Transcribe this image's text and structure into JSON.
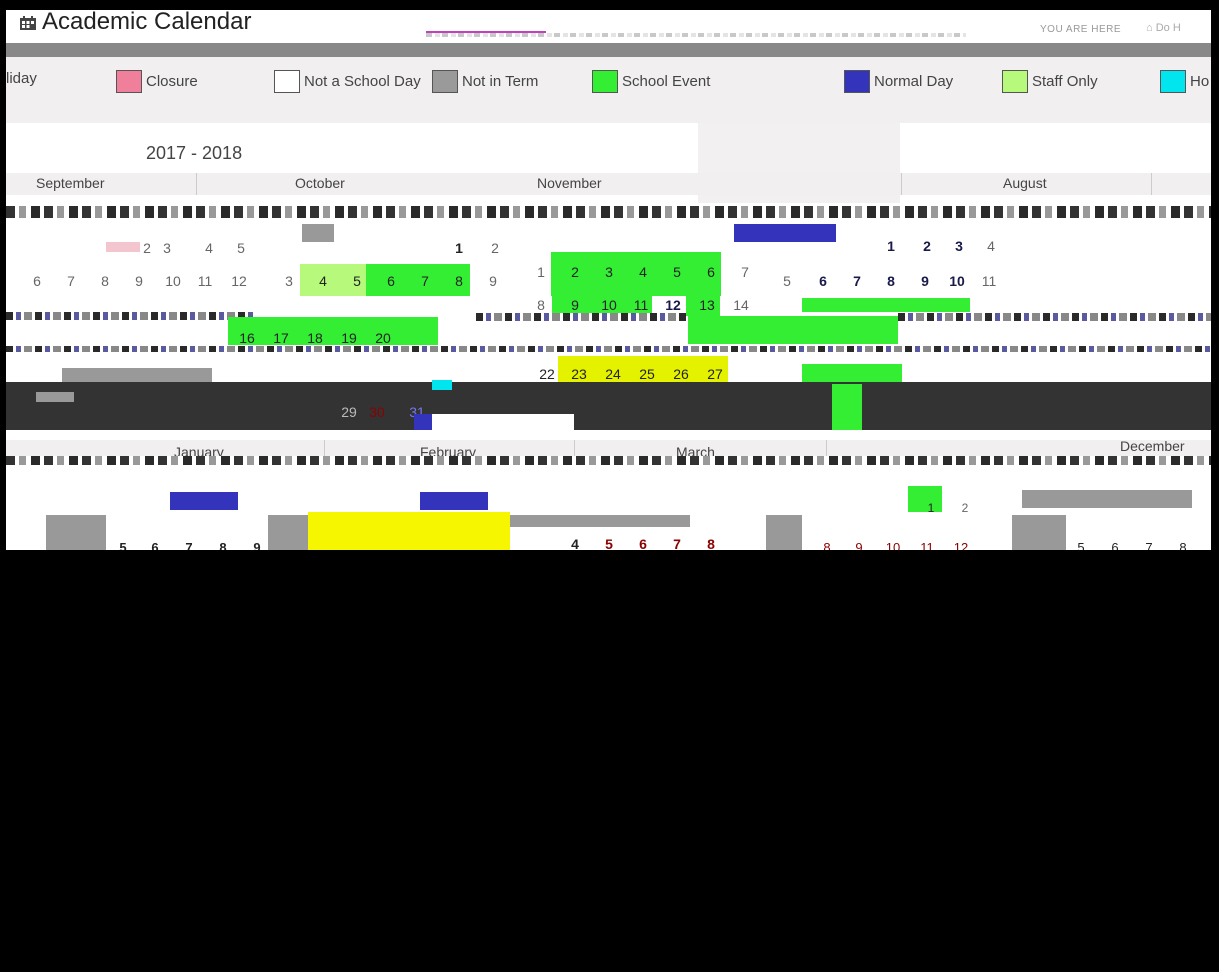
{
  "page": {
    "title": "Academic Calendar",
    "you_are_here": "YOU ARE HERE",
    "breadcrumb_home": "⌂ Do  H"
  },
  "legend": [
    {
      "label": "liday",
      "color": "#ffffff"
    },
    {
      "label": "Closure",
      "color": "#f07f9c"
    },
    {
      "label": "Not a School Day",
      "color": "#ffffff"
    },
    {
      "label": "Not in Term",
      "color": "#9a9a9a"
    },
    {
      "label": "School Event",
      "color": "#33ee33"
    },
    {
      "label": "Normal Day",
      "color": "#3333bb"
    },
    {
      "label": "Staff Only",
      "color": "#b7f97a"
    },
    {
      "label": "Ho",
      "color": "#00e5ee"
    }
  ],
  "year": "2017 - 2018",
  "months_row1": [
    "September",
    "October",
    "November",
    "August"
  ],
  "months_row2": [
    "January",
    "February",
    "March",
    "December"
  ],
  "weeks": {
    "september": {
      "row1": [
        "2",
        "3",
        "4",
        "5"
      ],
      "row2": [
        "6",
        "7",
        "8",
        "9",
        "10",
        "11",
        "12"
      ]
    },
    "october": {
      "row1": [
        "1",
        "2"
      ],
      "row2": [
        "3",
        "4",
        "5",
        "6",
        "7",
        "8",
        "9"
      ],
      "row3": [
        "16",
        "17",
        "18",
        "19",
        "20"
      ],
      "row5": [
        "29",
        "30",
        "31"
      ]
    },
    "november": {
      "row2": [
        "1",
        "2",
        "3",
        "4",
        "5",
        "6",
        "7"
      ],
      "row3": [
        "8",
        "9",
        "10",
        "11",
        "12",
        "13",
        "14"
      ],
      "row4": [
        "22",
        "23",
        "24",
        "25",
        "26",
        "27"
      ]
    },
    "august": {
      "row1": [
        "1",
        "2",
        "3",
        "4"
      ],
      "row2": [
        "5",
        "6",
        "7",
        "8",
        "9",
        "10",
        "11"
      ]
    },
    "row_bottom": {
      "jan": [
        "5",
        "6",
        "7",
        "8",
        "9"
      ],
      "mar": [
        "4",
        "5",
        "6",
        "7",
        "8"
      ],
      "mar_b": [
        "8",
        "9",
        "10",
        "11",
        "12"
      ],
      "dec": [
        "5",
        "6",
        "7",
        "8"
      ],
      "small": [
        "1",
        "2"
      ]
    }
  }
}
